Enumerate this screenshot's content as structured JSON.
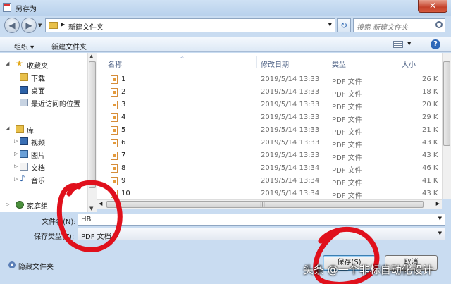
{
  "window": {
    "title": "另存为",
    "close_glyph": "✕"
  },
  "address": {
    "crumb": "新建文件夹",
    "search_placeholder": "搜索 新建文件夹"
  },
  "toolbar": {
    "organize": "组织 ▾",
    "new_folder": "新建文件夹"
  },
  "nav": {
    "favorites": "收藏夹",
    "downloads": "下载",
    "desktop": "桌面",
    "recent": "最近访问的位置",
    "libraries": "库",
    "videos": "视频",
    "pictures": "图片",
    "documents": "文档",
    "music": "音乐",
    "homegroup": "家庭组"
  },
  "columns": {
    "name": "名称",
    "date": "修改日期",
    "type": "类型",
    "size": "大小"
  },
  "files": [
    {
      "name": "1",
      "date": "2019/5/14 13:33",
      "type": "PDF 文件",
      "size": "26 K"
    },
    {
      "name": "2",
      "date": "2019/5/14 13:33",
      "type": "PDF 文件",
      "size": "18 K"
    },
    {
      "name": "3",
      "date": "2019/5/14 13:33",
      "type": "PDF 文件",
      "size": "20 K"
    },
    {
      "name": "4",
      "date": "2019/5/14 13:33",
      "type": "PDF 文件",
      "size": "29 K"
    },
    {
      "name": "5",
      "date": "2019/5/14 13:33",
      "type": "PDF 文件",
      "size": "21 K"
    },
    {
      "name": "6",
      "date": "2019/5/14 13:33",
      "type": "PDF 文件",
      "size": "43 K"
    },
    {
      "name": "7",
      "date": "2019/5/14 13:33",
      "type": "PDF 文件",
      "size": "43 K"
    },
    {
      "name": "8",
      "date": "2019/5/14 13:34",
      "type": "PDF 文件",
      "size": "46 K"
    },
    {
      "name": "9",
      "date": "2019/5/14 13:34",
      "type": "PDF 文件",
      "size": "41 K"
    },
    {
      "name": "10",
      "date": "2019/5/14 13:34",
      "type": "PDF 文件",
      "size": "43 K"
    }
  ],
  "form": {
    "filename_label": "文件名(N):",
    "filename_value": "HB",
    "filetype_label": "保存类型(T):",
    "filetype_value": "PDF 文档"
  },
  "footer": {
    "hide_folders": "隐藏文件夹",
    "save": "保存(S)",
    "cancel": "取消"
  },
  "watermark": "头条 @一个非标自动化设计",
  "annotation_color": "#e0101c"
}
